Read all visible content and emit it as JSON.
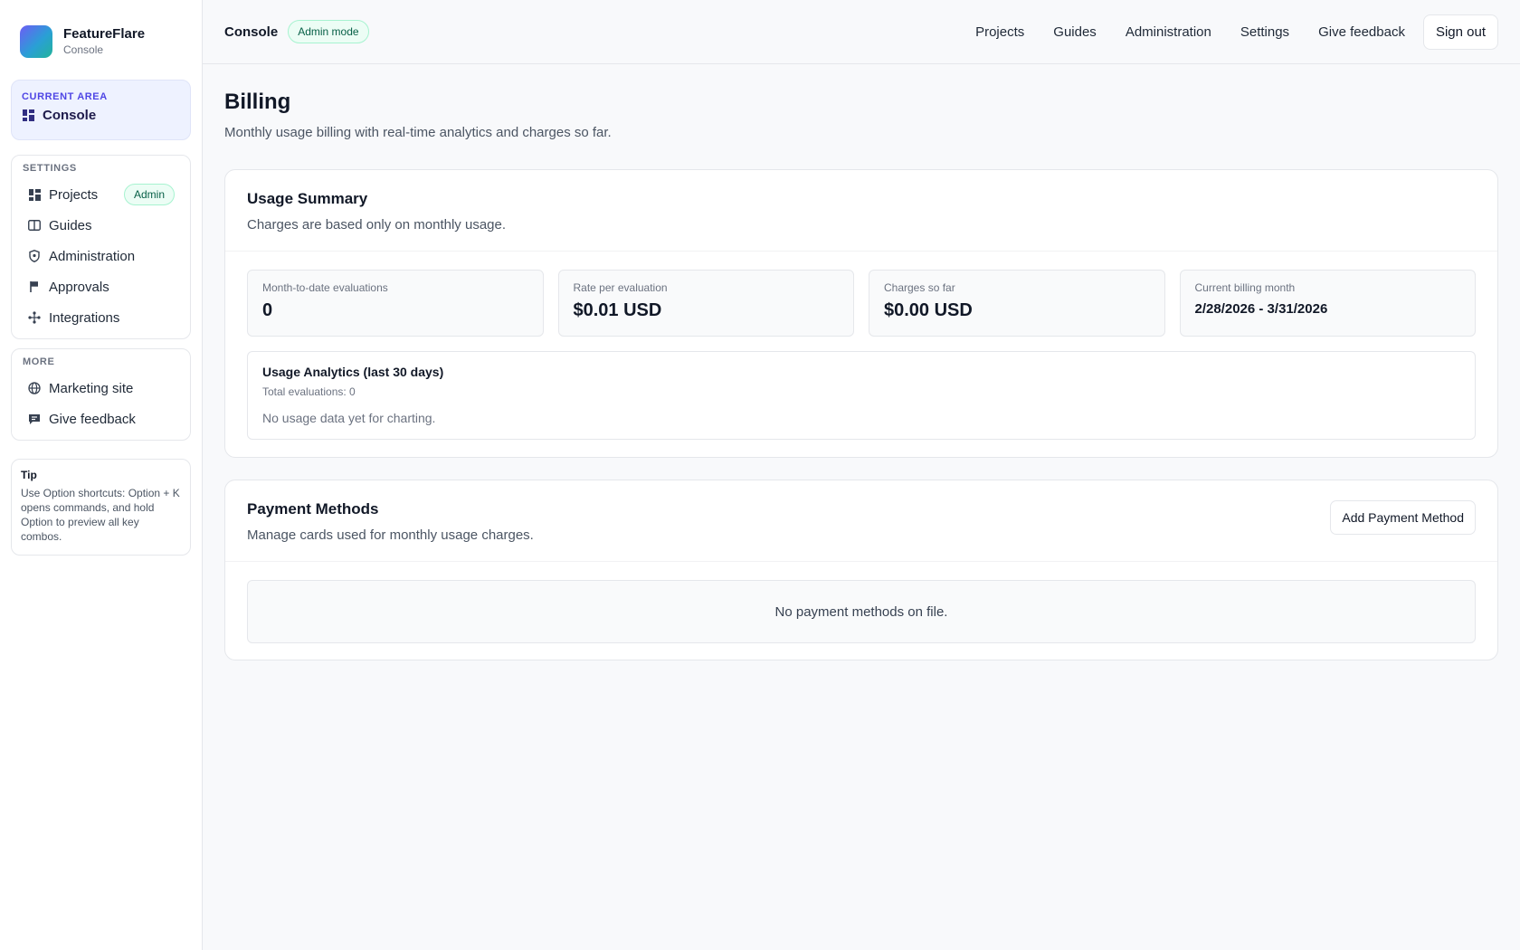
{
  "brand": {
    "name": "FeatureFlare",
    "subtitle": "Console"
  },
  "sidebar": {
    "current_area": {
      "kicker": "CURRENT AREA",
      "label": "Console",
      "icon": "grid-icon"
    },
    "settings": {
      "kicker": "SETTINGS",
      "items": [
        {
          "label": "Projects",
          "icon": "grid-icon",
          "badge": "Admin"
        },
        {
          "label": "Guides",
          "icon": "book-icon"
        },
        {
          "label": "Administration",
          "icon": "shield-icon"
        },
        {
          "label": "Approvals",
          "icon": "flag-icon"
        },
        {
          "label": "Integrations",
          "icon": "workflow-icon"
        }
      ]
    },
    "more": {
      "kicker": "MORE",
      "items": [
        {
          "label": "Marketing site",
          "icon": "globe-icon"
        },
        {
          "label": "Give feedback",
          "icon": "message-icon"
        }
      ]
    },
    "tip": {
      "title": "Tip",
      "text": "Use Option shortcuts: Option + K opens commands, and hold Option to preview all key combos."
    }
  },
  "topbar": {
    "title": "Console",
    "mode_badge": "Admin mode",
    "links": [
      "Projects",
      "Guides",
      "Administration",
      "Settings",
      "Give feedback"
    ],
    "signout": "Sign out"
  },
  "page": {
    "title": "Billing",
    "subtitle": "Monthly usage billing with real-time analytics and charges so far."
  },
  "usage": {
    "title": "Usage Summary",
    "subtitle": "Charges are based only on monthly usage.",
    "stats": [
      {
        "label": "Month-to-date evaluations",
        "value": "0"
      },
      {
        "label": "Rate per evaluation",
        "value": "$0.01 USD"
      },
      {
        "label": "Charges so far",
        "value": "$0.00 USD"
      },
      {
        "label": "Current billing month",
        "value": "2/28/2026 - 3/31/2026"
      }
    ],
    "analytics": {
      "title": "Usage Analytics (last 30 days)",
      "total": "Total evaluations: 0",
      "empty": "No usage data yet for charting."
    }
  },
  "payment": {
    "title": "Payment Methods",
    "subtitle": "Manage cards used for monthly usage charges.",
    "add_button": "Add Payment Method",
    "empty": "No payment methods on file."
  }
}
